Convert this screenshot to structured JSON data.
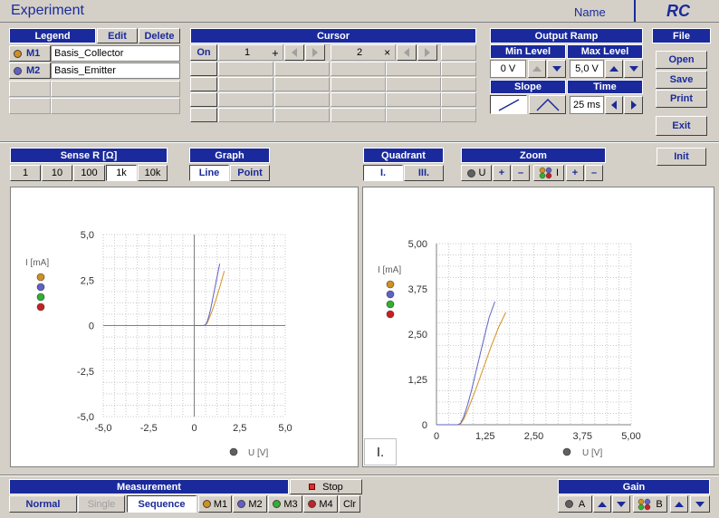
{
  "app": {
    "title": "Experiment",
    "name_label": "Name",
    "logo": "RC"
  },
  "legend": {
    "header": "Legend",
    "edit": "Edit",
    "delete": "Delete",
    "items": [
      {
        "id": "M1",
        "label": "Basis_Collector",
        "color": "#d09020"
      },
      {
        "id": "M2",
        "label": "Basis_Emitter",
        "color": "#6060c8"
      }
    ]
  },
  "cursor": {
    "header": "Cursor",
    "on": "On",
    "c1": "1",
    "c1_symbol": "+",
    "c2": "2",
    "c2_symbol": "×"
  },
  "output_ramp": {
    "header": "Output Ramp",
    "min_level_label": "Min Level",
    "max_level_label": "Max Level",
    "min_level": "0 V",
    "max_level": "5,0 V",
    "slope_label": "Slope",
    "time_label": "Time",
    "time": "25 ms"
  },
  "file": {
    "header": "File",
    "open": "Open",
    "save": "Save",
    "print": "Print",
    "exit": "Exit"
  },
  "sense_r": {
    "header": "Sense R  [Ω]",
    "options": [
      "1",
      "10",
      "100",
      "1k",
      "10k"
    ],
    "selected": "1k"
  },
  "graph": {
    "header": "Graph",
    "line": "Line",
    "point": "Point",
    "selected": "Line"
  },
  "quadrant": {
    "header": "Quadrant",
    "q1": "I.",
    "q3": "III.",
    "selected": "I."
  },
  "zoom": {
    "header": "Zoom",
    "u_label": "U",
    "i_label": "I",
    "plus": "+",
    "minus": "–"
  },
  "init": "Init",
  "measurement": {
    "header": "Measurement",
    "stop": "Stop",
    "normal": "Normal",
    "single": "Single",
    "sequence": "Sequence",
    "m1": "M1",
    "m2": "M2",
    "m3": "M3",
    "m4": "M4",
    "clr": "Clr"
  },
  "gain": {
    "header": "Gain",
    "a": "A",
    "b": "B"
  },
  "colors": {
    "m1": "#d09020",
    "m2": "#6060c8",
    "m3": "#30b030",
    "m4": "#c82020",
    "accent": "#1a2a9c"
  },
  "chart_data": [
    {
      "type": "line",
      "title": "",
      "xlabel": "U [V]",
      "ylabel": "I [mA]",
      "xlim": [
        -5.0,
        5.0
      ],
      "ylim": [
        -5.0,
        5.0
      ],
      "xticks": [
        "-5,0",
        "-2,5",
        "0",
        "2,5",
        "5,0"
      ],
      "yticks": [
        "5,0",
        "2,5",
        "0",
        "-2,5",
        "-5,0"
      ],
      "grid": true,
      "series": [
        {
          "name": "M1",
          "x": [
            0,
            0.5,
            0.6,
            0.7,
            0.8,
            1.0,
            1.2,
            1.4,
            1.65
          ],
          "y": [
            0,
            0,
            0.02,
            0.12,
            0.35,
            0.85,
            1.45,
            2.1,
            3.0
          ]
        },
        {
          "name": "M2",
          "x": [
            0,
            0.5,
            0.6,
            0.7,
            0.8,
            0.9,
            1.0,
            1.2,
            1.4
          ],
          "y": [
            0,
            0,
            0.03,
            0.18,
            0.5,
            0.9,
            1.4,
            2.4,
            3.4
          ]
        }
      ]
    },
    {
      "type": "line",
      "title": "",
      "xlabel": "U [V]",
      "ylabel": "I [mA]",
      "quadrant_label": "I.",
      "xlim": [
        0,
        5.0
      ],
      "ylim": [
        0,
        5.0
      ],
      "xticks": [
        "0",
        "1,25",
        "2,50",
        "3,75",
        "5,00"
      ],
      "yticks": [
        "5,00",
        "3,75",
        "2,50",
        "1,25",
        "0"
      ],
      "grid": true,
      "series": [
        {
          "name": "M1",
          "x": [
            0,
            0.55,
            0.62,
            0.7,
            0.8,
            1.0,
            1.2,
            1.4,
            1.6,
            1.78
          ],
          "y": [
            0,
            0,
            0.03,
            0.15,
            0.4,
            0.95,
            1.55,
            2.15,
            2.7,
            3.1
          ]
        },
        {
          "name": "M2",
          "x": [
            0,
            0.55,
            0.62,
            0.7,
            0.8,
            0.9,
            1.0,
            1.2,
            1.35,
            1.5
          ],
          "y": [
            0,
            0,
            0.04,
            0.22,
            0.55,
            0.95,
            1.4,
            2.3,
            2.95,
            3.4
          ]
        }
      ]
    }
  ]
}
